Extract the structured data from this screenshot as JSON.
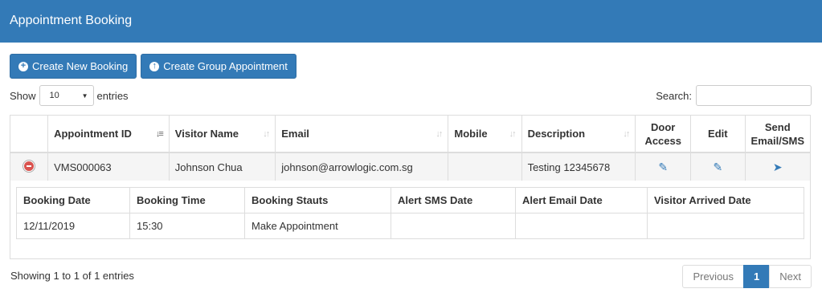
{
  "header": {
    "title": "Appointment Booking"
  },
  "toolbar": {
    "create_booking_label": "Create New Booking",
    "create_group_label": "Create Group Appointment"
  },
  "length": {
    "show_label": "Show",
    "value": "10",
    "entries_label": "entries"
  },
  "search": {
    "label": "Search:"
  },
  "table": {
    "columns": [
      "Appointment ID",
      "Visitor Name",
      "Email",
      "Mobile",
      "Description",
      "Door Access",
      "Edit",
      "Send Email/SMS"
    ],
    "rows": [
      {
        "appointment_id": "VMS000063",
        "visitor_name": "Johnson Chua",
        "email": "johnson@arrowlogic.com.sg",
        "mobile": "",
        "description": "Testing 12345678"
      }
    ],
    "detail": {
      "columns": [
        "Booking Date",
        "Booking Time",
        "Booking Stauts",
        "Alert SMS Date",
        "Alert Email Date",
        "Visitor Arrived Date"
      ],
      "values": [
        "12/11/2019",
        "15:30",
        "Make Appointment",
        "",
        "",
        ""
      ]
    }
  },
  "info": "Showing 1 to 1 of 1 entries",
  "pagination": {
    "previous": "Previous",
    "current": "1",
    "next": "Next"
  },
  "colors": {
    "primary": "#337ab7",
    "danger": "#d9534f"
  },
  "icons": [
    "plus-circle-icon",
    "upload-circle-icon",
    "sort-icon",
    "minus-circle-icon",
    "edit-icon",
    "send-icon",
    "chevron-down-icon"
  ]
}
